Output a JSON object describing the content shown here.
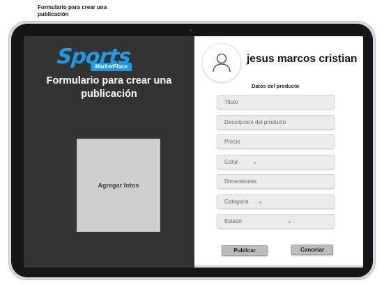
{
  "frame": {
    "label": "Formulario para crear una publicación"
  },
  "logo": {
    "main_text": "Sports",
    "sub_text": "MarketPlace"
  },
  "left_panel": {
    "title": "Formulario para crear una publicación",
    "photo_label": "Agregar fotos"
  },
  "profile": {
    "avatar_icon": "user-avatar-icon",
    "username": "jesus marcos cristian"
  },
  "form": {
    "section_title": "Datos del producto",
    "fields": [
      {
        "placeholder": "Titulo"
      },
      {
        "placeholder": "Descripcion del producto"
      },
      {
        "placeholder": "Precio"
      },
      {
        "placeholder": "Color"
      },
      {
        "placeholder": "Dimensiones"
      },
      {
        "placeholder": "Categoria"
      },
      {
        "placeholder": "Estado"
      }
    ],
    "publish_label": "Publicar",
    "cancel_label": "Cancelar"
  },
  "colors": {
    "brand": "#1e9be6",
    "left_panel_bg": "#333333",
    "field_bg": "#ebebeb",
    "button_bg": "#bdbdbd"
  }
}
